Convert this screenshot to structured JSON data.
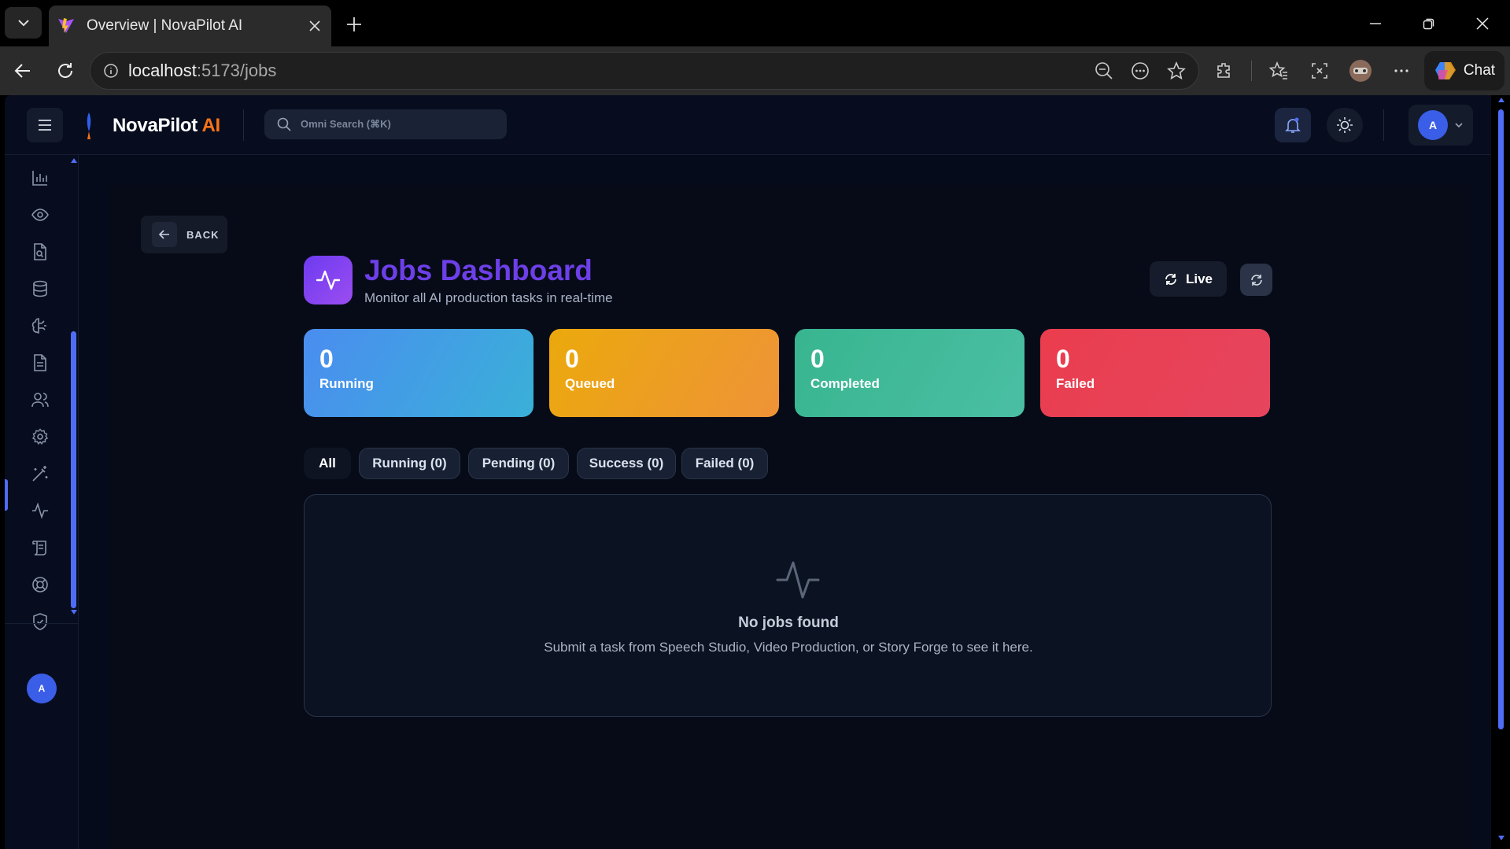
{
  "browser": {
    "tab_title": "Overview | NovaPilot AI",
    "url_host": "localhost",
    "url_path": ":5173/jobs",
    "chat_label": "Chat"
  },
  "app": {
    "brand_main": "NovaPilot",
    "brand_accent": "AI",
    "search_placeholder": "Omni Search (⌘K)",
    "user_initial": "A",
    "sidebar_user_initial": "A"
  },
  "sidebar": {
    "items": [
      {
        "icon": "chart-icon"
      },
      {
        "icon": "eye-icon"
      },
      {
        "icon": "document-search-icon"
      },
      {
        "icon": "database-icon"
      },
      {
        "icon": "brain-icon"
      },
      {
        "icon": "file-text-icon"
      },
      {
        "icon": "users-icon"
      },
      {
        "icon": "gear-icon",
        "active": true
      },
      {
        "icon": "magic-wand-icon"
      },
      {
        "icon": "activity-icon"
      },
      {
        "icon": "scroll-icon"
      },
      {
        "icon": "lifebuoy-icon"
      },
      {
        "icon": "shield-icon"
      }
    ]
  },
  "page": {
    "back_label": "BACK",
    "title": "Jobs Dashboard",
    "subtitle": "Monitor all AI production tasks in real-time",
    "live_label": "Live"
  },
  "stats": [
    {
      "value": "0",
      "label": "Running",
      "color_from": "#4a8df0",
      "color_to": "#3ab0d8"
    },
    {
      "value": "0",
      "label": "Queued",
      "color_from": "#eba90c",
      "color_to": "#ee9338"
    },
    {
      "value": "0",
      "label": "Completed",
      "color_from": "#38b58f",
      "color_to": "#4bbfa4"
    },
    {
      "value": "0",
      "label": "Failed",
      "color_from": "#ea3d4e",
      "color_to": "#e6455e"
    }
  ],
  "filters": [
    {
      "label": "All",
      "active": true
    },
    {
      "label": "Running (0)"
    },
    {
      "label": "Pending (0)"
    },
    {
      "label": "Success (0)"
    },
    {
      "label": "Failed (0)"
    }
  ],
  "empty": {
    "title": "No jobs found",
    "subtitle": "Submit a task from Speech Studio, Video Production, or Story Forge to see it here."
  },
  "colors": {
    "accent": "#4f6cf5",
    "title_purple": "#6d3fe8",
    "brand_orange": "#f97316"
  }
}
